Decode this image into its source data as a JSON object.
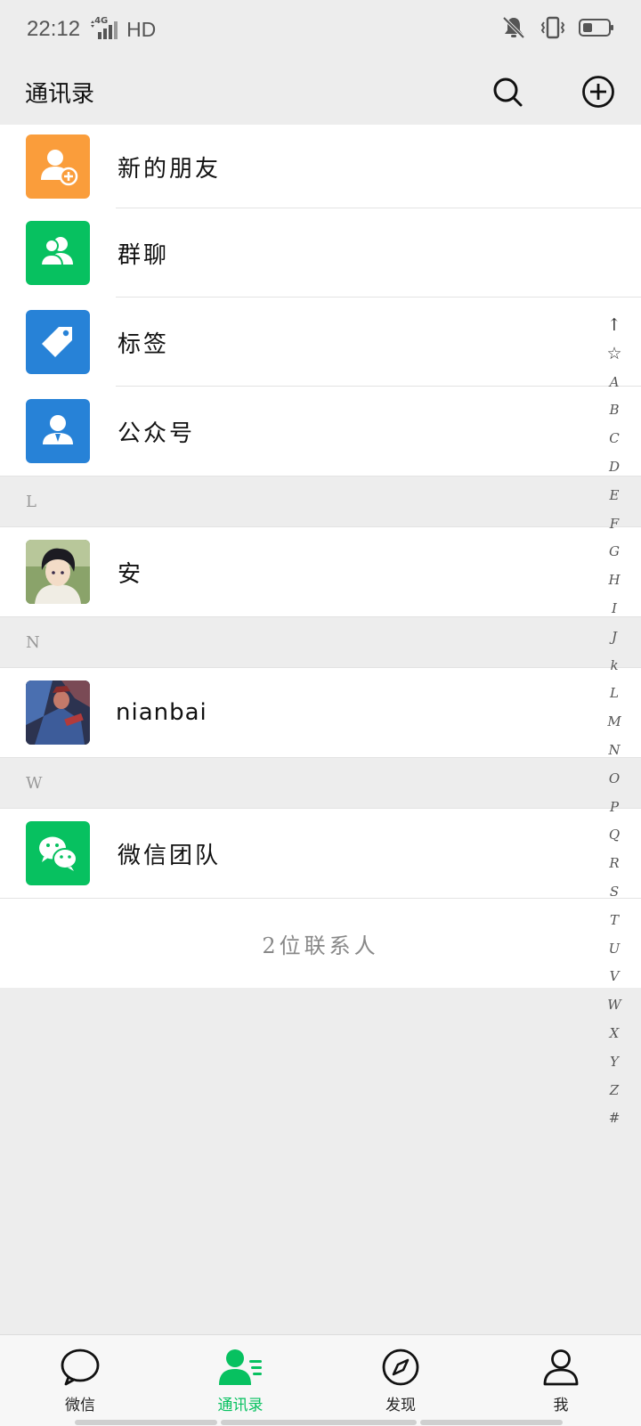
{
  "status": {
    "time": "22:12",
    "network": "4G",
    "hd": "HD"
  },
  "header": {
    "title": "通讯录"
  },
  "features": [
    {
      "label": "新的朋友",
      "color": "#fa9d3b"
    },
    {
      "label": "群聊",
      "color": "#07c160"
    },
    {
      "label": "标签",
      "color": "#2782d7"
    },
    {
      "label": "公众号",
      "color": "#2782d7"
    }
  ],
  "groups": [
    {
      "letter": "L",
      "contacts": [
        {
          "name": "安"
        }
      ]
    },
    {
      "letter": "N",
      "contacts": [
        {
          "name": "nianbai"
        }
      ]
    },
    {
      "letter": "W",
      "contacts": [
        {
          "name": "微信团队"
        }
      ]
    }
  ],
  "contact_count": "2位联系人",
  "alphabet": [
    "↑",
    "☆",
    "A",
    "B",
    "C",
    "D",
    "E",
    "F",
    "G",
    "H",
    "I",
    "J",
    "k",
    "L",
    "M",
    "N",
    "O",
    "P",
    "Q",
    "R",
    "S",
    "T",
    "U",
    "V",
    "W",
    "X",
    "Y",
    "Z",
    "#"
  ],
  "tabs": [
    {
      "label": "微信",
      "active": false
    },
    {
      "label": "通讯录",
      "active": true
    },
    {
      "label": "发现",
      "active": false
    },
    {
      "label": "我",
      "active": false
    }
  ],
  "colors": {
    "accent": "#07c160",
    "background": "#ededed"
  }
}
